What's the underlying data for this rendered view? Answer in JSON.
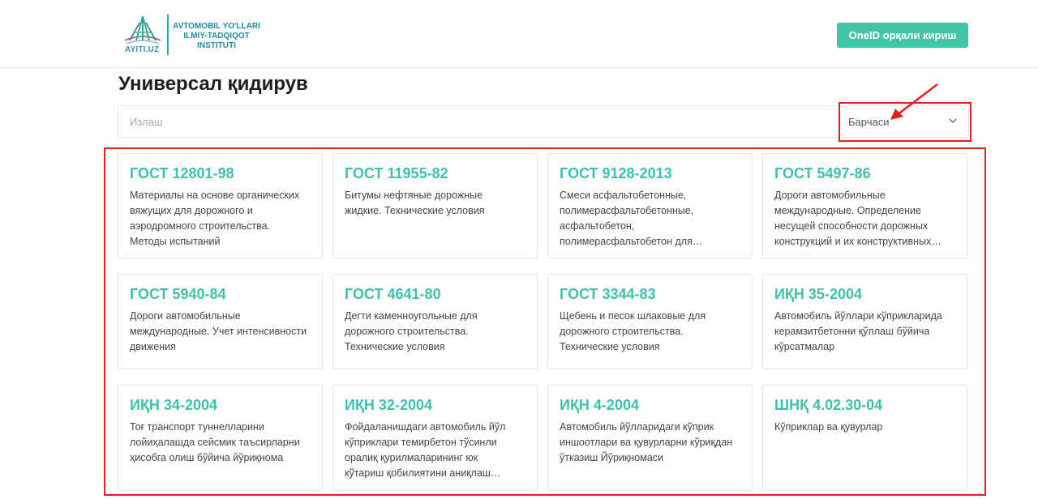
{
  "header": {
    "logo_sub": "AYITI.UZ",
    "logo_lines": [
      "AVTOMOBIL YO'LLARI",
      "ILMIY-TADQIQOT",
      "INSTITUTI"
    ],
    "login_button": "OneID орқали кириш"
  },
  "page": {
    "title": "Универсал қидирув"
  },
  "search": {
    "placeholder": "Излаш",
    "filter_value": "Барчаси"
  },
  "cards": [
    {
      "title": "ГОСТ 12801-98",
      "lines": [
        "Материалы на основе органических",
        "вяжущих для дорожного и",
        "аэродромного строительства.",
        "Методы испытаний"
      ]
    },
    {
      "title": "ГОСТ 11955-82",
      "lines": [
        "Битумы нефтяные дорожные",
        "жидкие. Технические условия"
      ]
    },
    {
      "title": "ГОСТ 9128-2013",
      "lines": [
        "Смеси асфальтобетонные,",
        "полимерасфальтобетонные,",
        "асфальтобетон,",
        "полимерасфальтобетон для…"
      ]
    },
    {
      "title": "ГОСТ 5497-86",
      "lines": [
        "Дороги автомобильные",
        "международные. Определение",
        "несущей способности дорожных",
        "конструкций и их конструктивных…"
      ]
    },
    {
      "title": "ГОСТ 5940-84",
      "lines": [
        "Дороги автомобильные",
        "международные. Учет интенсивности",
        "движения"
      ]
    },
    {
      "title": "ГОСТ 4641-80",
      "lines": [
        "Дегти каменноугольные для",
        "дорожного строительства.",
        "Технические условия"
      ]
    },
    {
      "title": "ГОСТ 3344-83",
      "lines": [
        "Щебень и песок шлаковые для",
        "дорожного строительства.",
        "Технические условия"
      ]
    },
    {
      "title": "ИҚН 35-2004",
      "lines": [
        "Автомобиль йўллари кўприкларида",
        "керамзитбетонни қўллаш бўйича",
        "кўрсатмалар"
      ]
    },
    {
      "title": "ИҚН 34-2004",
      "lines": [
        "Тоғ транспорт туннелларини",
        "лойиҳалашда сейсмик таъсирларни",
        "ҳисобга олиш бўйича йўриқнома"
      ]
    },
    {
      "title": "ИҚН 32-2004",
      "lines": [
        "Фойдаланишдаги автомобиль йўл",
        "кўприклари темирбетон тўсинли",
        "оралиқ қурилмаларининг юк",
        "кўтариш қобилиятини аниқлаш…"
      ]
    },
    {
      "title": "ИҚН 4-2004",
      "lines": [
        "Автомобиль йўлларидаги кўприк",
        "иншоотлари ва қувурларни кўриқдан",
        "ўтказиш Йўриқномаси"
      ]
    },
    {
      "title": "ШНҚ 4.02.30-04",
      "lines": [
        "Кўприклар ва қувурлар"
      ]
    }
  ],
  "colors": {
    "accent": "#43c5a5",
    "card_title": "#3fc0ac",
    "highlight": "#e0221f"
  }
}
